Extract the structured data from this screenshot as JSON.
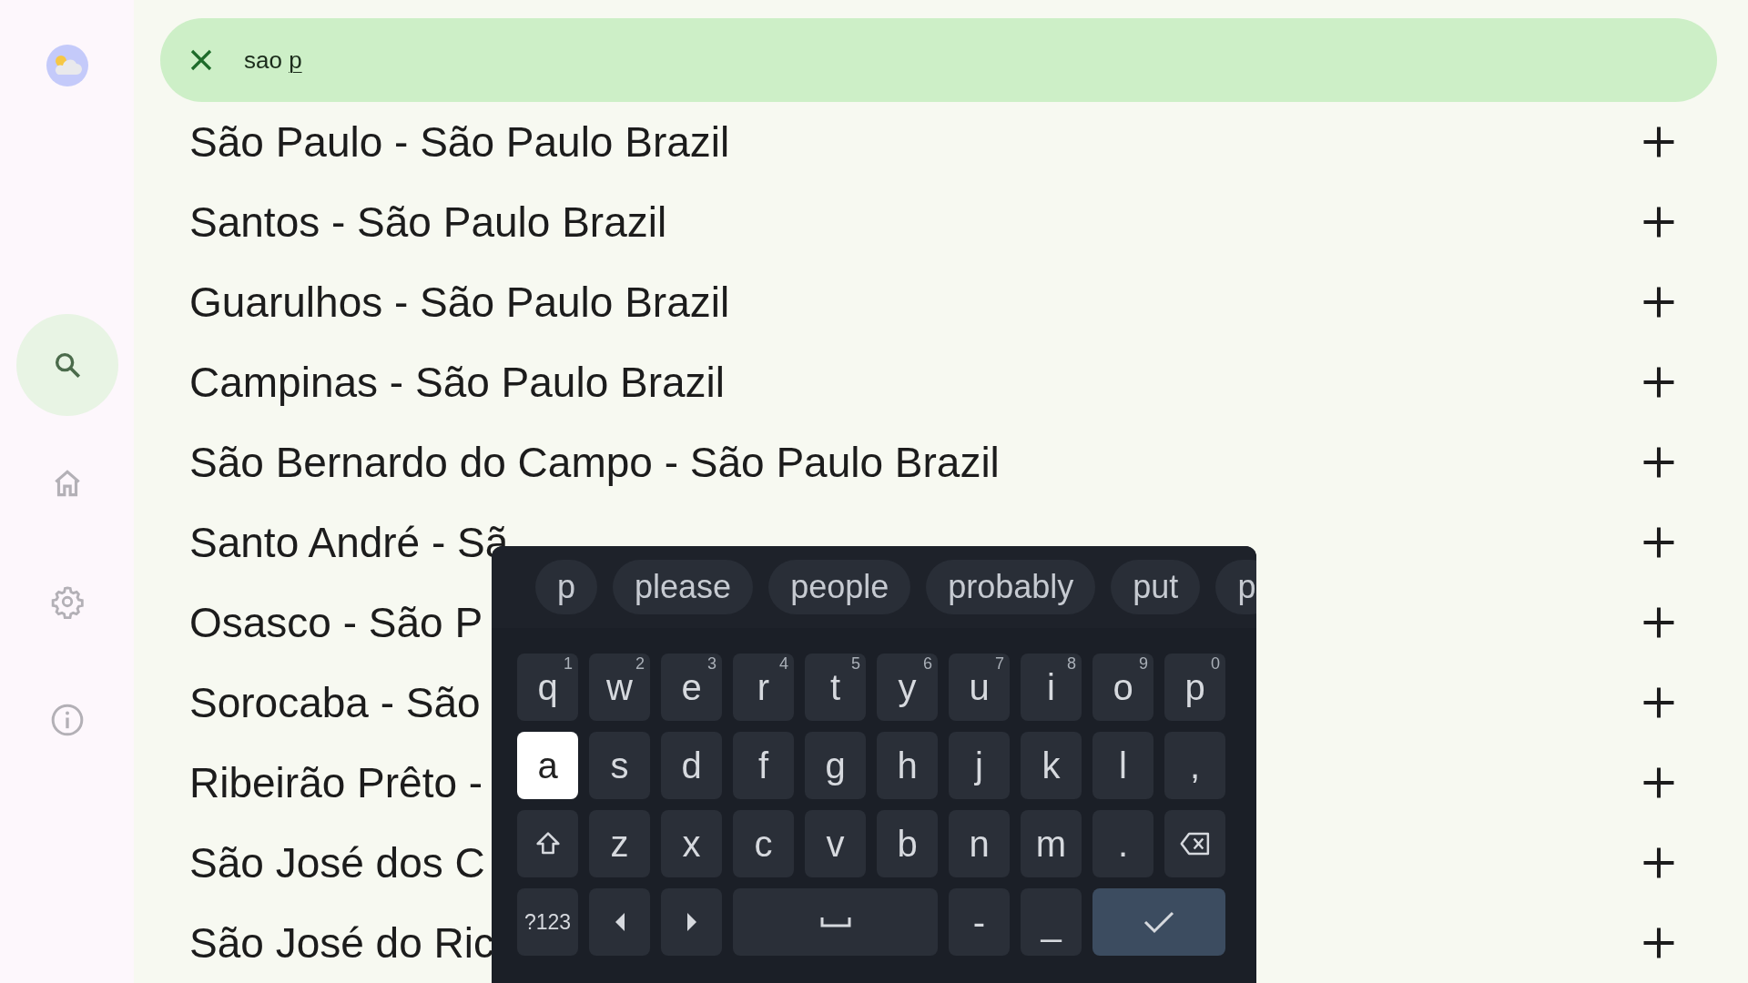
{
  "sidebar": {
    "items": [
      {
        "kind": "search",
        "selected": true
      },
      {
        "kind": "home",
        "selected": false
      },
      {
        "kind": "settings",
        "selected": false
      },
      {
        "kind": "info",
        "selected": false
      }
    ]
  },
  "search": {
    "value": "sao p"
  },
  "results": [
    {
      "name": "São Paulo - São Paulo Brazil"
    },
    {
      "name": "Santos - São Paulo Brazil"
    },
    {
      "name": "Guarulhos - São Paulo Brazil"
    },
    {
      "name": "Campinas - São Paulo Brazil"
    },
    {
      "name": "São Bernardo do Campo - São Paulo Brazil"
    },
    {
      "name": "Santo André - Sã"
    },
    {
      "name": "Osasco - São P"
    },
    {
      "name": "Sorocaba - São"
    },
    {
      "name": "Ribeirão Prêto -"
    },
    {
      "name": "São José dos C"
    },
    {
      "name": "São José do Ric"
    }
  ],
  "keyboard": {
    "suggestions": [
      "p",
      "please",
      "people",
      "probably",
      "put",
      "p"
    ],
    "rows": [
      [
        {
          "kind": "letter",
          "label": "q",
          "hint": "1",
          "pressed": false
        },
        {
          "kind": "letter",
          "label": "w",
          "hint": "2",
          "pressed": false
        },
        {
          "kind": "letter",
          "label": "e",
          "hint": "3",
          "pressed": false
        },
        {
          "kind": "letter",
          "label": "r",
          "hint": "4",
          "pressed": false
        },
        {
          "kind": "letter",
          "label": "t",
          "hint": "5",
          "pressed": false
        },
        {
          "kind": "letter",
          "label": "y",
          "hint": "6",
          "pressed": false
        },
        {
          "kind": "letter",
          "label": "u",
          "hint": "7",
          "pressed": false
        },
        {
          "kind": "letter",
          "label": "i",
          "hint": "8",
          "pressed": false
        },
        {
          "kind": "letter",
          "label": "o",
          "hint": "9",
          "pressed": false
        },
        {
          "kind": "letter",
          "label": "p",
          "hint": "0",
          "pressed": false
        }
      ],
      [
        {
          "kind": "letter",
          "label": "a",
          "pressed": true
        },
        {
          "kind": "letter",
          "label": "s",
          "pressed": false
        },
        {
          "kind": "letter",
          "label": "d",
          "pressed": false
        },
        {
          "kind": "letter",
          "label": "f",
          "pressed": false
        },
        {
          "kind": "letter",
          "label": "g",
          "pressed": false
        },
        {
          "kind": "letter",
          "label": "h",
          "pressed": false
        },
        {
          "kind": "letter",
          "label": "j",
          "pressed": false
        },
        {
          "kind": "letter",
          "label": "k",
          "pressed": false
        },
        {
          "kind": "letter",
          "label": "l",
          "pressed": false
        },
        {
          "kind": "letter",
          "label": ",",
          "pressed": false
        }
      ],
      [
        {
          "kind": "shift",
          "pressed": false
        },
        {
          "kind": "letter",
          "label": "z",
          "pressed": false
        },
        {
          "kind": "letter",
          "label": "x",
          "pressed": false
        },
        {
          "kind": "letter",
          "label": "c",
          "pressed": false
        },
        {
          "kind": "letter",
          "label": "v",
          "pressed": false
        },
        {
          "kind": "letter",
          "label": "b",
          "pressed": false
        },
        {
          "kind": "letter",
          "label": "n",
          "pressed": false
        },
        {
          "kind": "letter",
          "label": "m",
          "pressed": false
        },
        {
          "kind": "letter",
          "label": ".",
          "pressed": false
        },
        {
          "kind": "backspace",
          "pressed": false
        }
      ]
    ],
    "bottom_row": [
      {
        "kind": "symbols",
        "label": "?123",
        "pressed": false
      },
      {
        "kind": "left",
        "pressed": false
      },
      {
        "kind": "right",
        "pressed": false
      },
      {
        "kind": "space",
        "pressed": false
      },
      {
        "kind": "letter",
        "label": "-",
        "pressed": false
      },
      {
        "kind": "letter",
        "label": "_",
        "pressed": false
      },
      {
        "kind": "enter",
        "pressed": false
      }
    ]
  }
}
